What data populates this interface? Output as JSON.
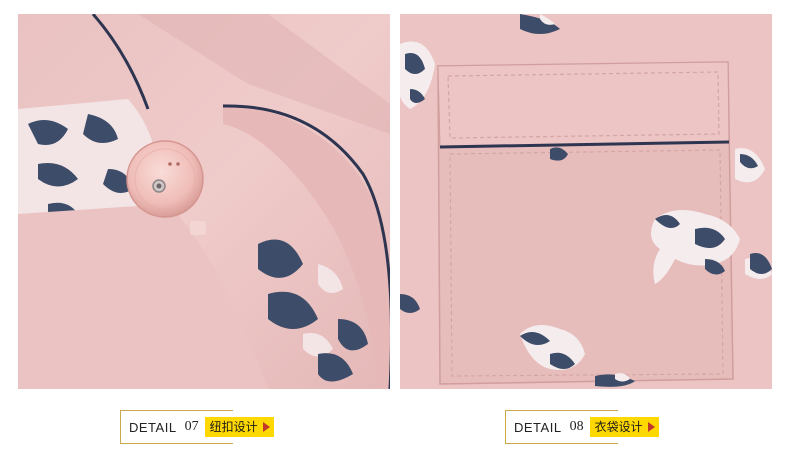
{
  "details": [
    {
      "word": "DETAIL",
      "number": "07",
      "tag": "纽扣设计"
    },
    {
      "word": "DETAIL",
      "number": "08",
      "tag": "衣袋设计"
    }
  ],
  "colors": {
    "fabric": "#edc7c6",
    "fabric_shade": "#e2b3b2",
    "print_navy": "#3d4c68",
    "piping": "#2e3550",
    "button": "#f1c2be",
    "tag_bg": "#ffd800",
    "frame": "#c9a94a",
    "tag_arrow": "#c0392b"
  }
}
